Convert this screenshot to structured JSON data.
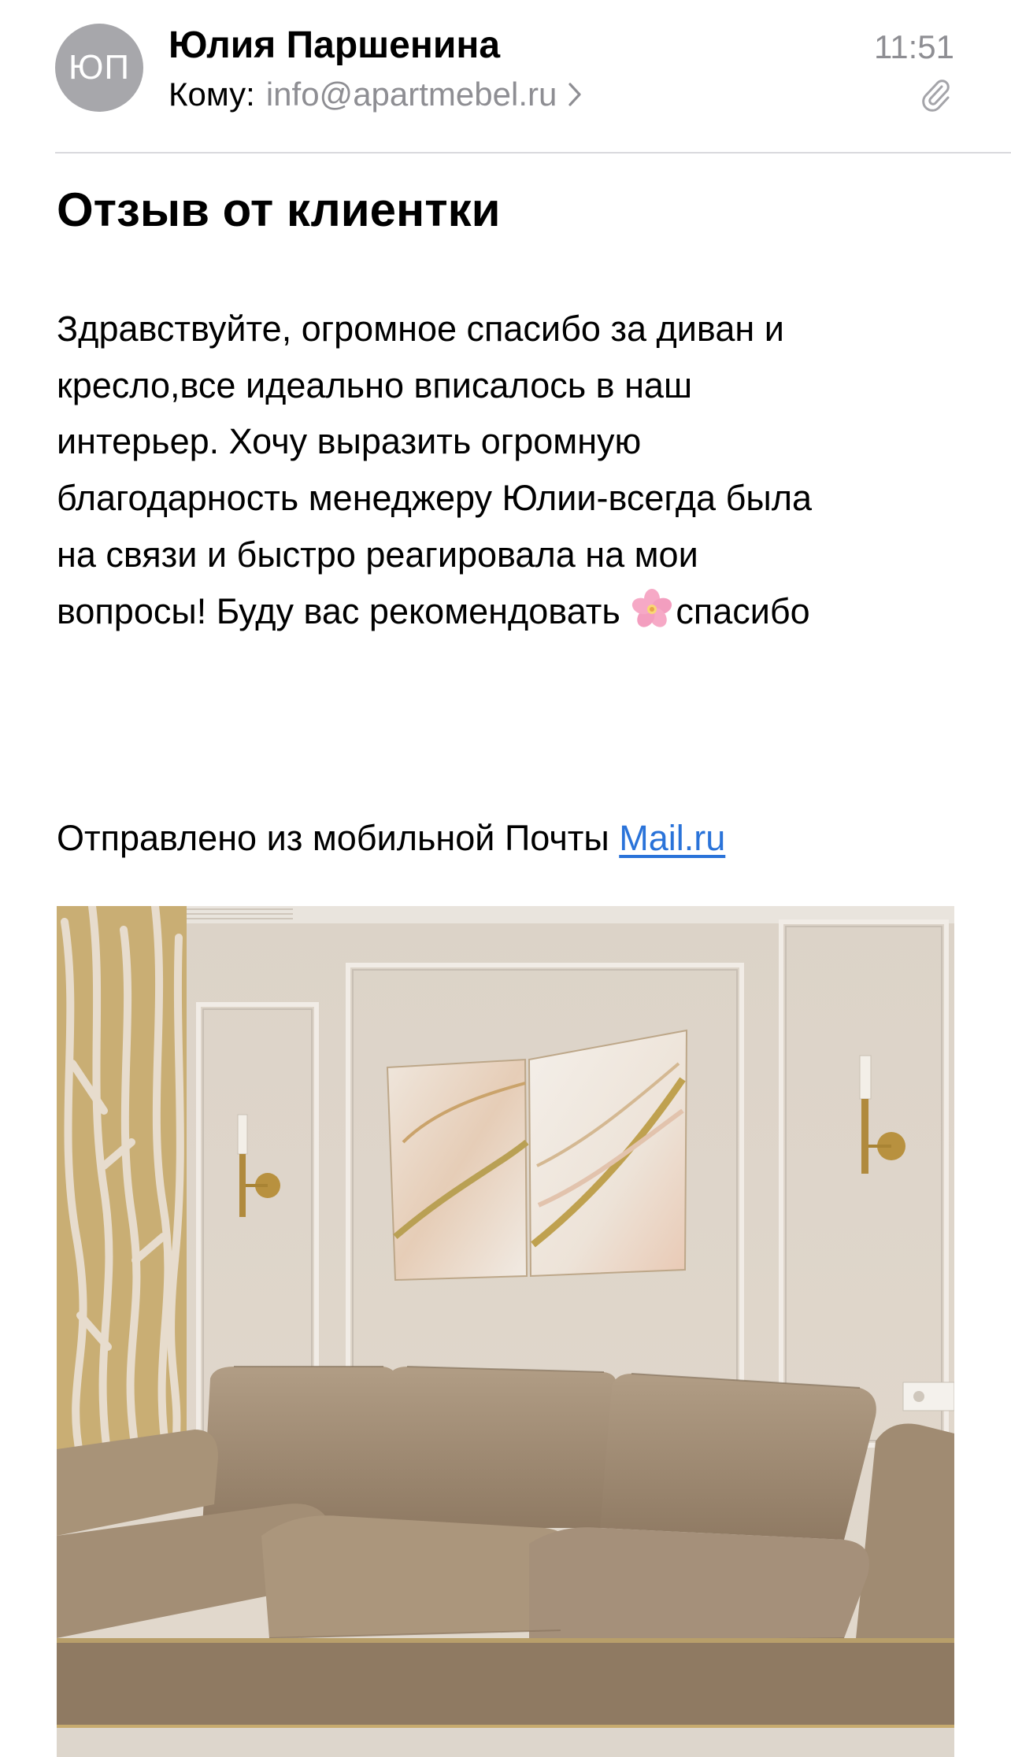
{
  "header": {
    "avatar_initials": "ЮП",
    "sender_name": "Юлия Паршенина",
    "to_label": "Кому:",
    "to_address": "info@apartmebel.ru",
    "time": "11:51",
    "icons": {
      "chevron": "chevron-right-icon",
      "attachment": "paperclip-icon"
    }
  },
  "message": {
    "subject": "Отзыв от клиентки",
    "body_lines": [
      "Здравствуйте, огромное спасибо за диван и",
      "кресло,все идеально вписалось в наш",
      "интерьер. Хочу выразить огромную",
      "благодарность менеджеру Юлии-всегда была",
      "на связи и быстро реагировала на мои",
      "вопросы! Буду вас рекомендовать"
    ],
    "body_emoji": "🌸",
    "body_last_word": "спасибо",
    "signature_prefix": "Отправлено из мобильной Почты",
    "signature_link": "Mail.ru"
  },
  "attachment_image": {
    "kind": "photo",
    "subject": "living-room-sofa"
  },
  "colors": {
    "link": "#2a73d9",
    "secondary_text": "#8e8e93",
    "avatar_bg": "#a7a7ab",
    "divider": "#d9d9dd"
  }
}
